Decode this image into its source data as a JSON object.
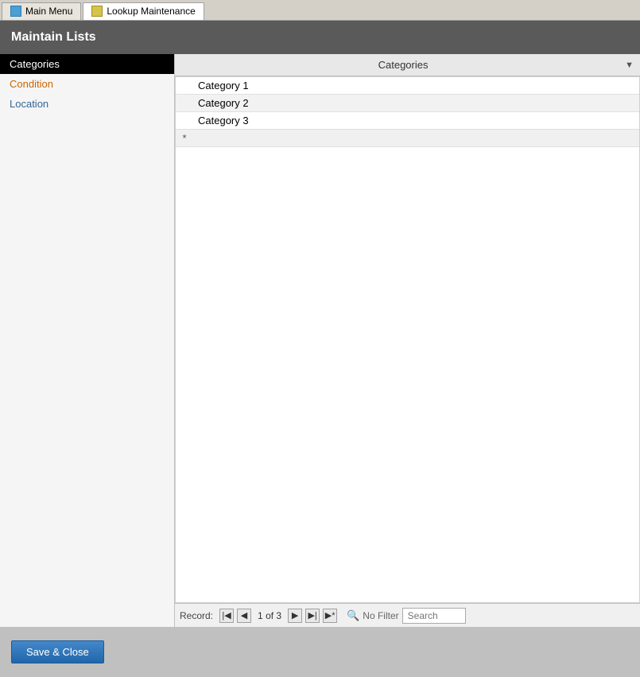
{
  "tabs": [
    {
      "id": "main-menu",
      "label": "Main Menu",
      "icon": "main-icon",
      "active": false
    },
    {
      "id": "lookup-maintenance",
      "label": "Lookup Maintenance",
      "icon": "lookup-icon",
      "active": true
    }
  ],
  "title": "Maintain Lists",
  "left_panel": {
    "items": [
      {
        "id": "categories",
        "label": "Categories",
        "selected": true
      },
      {
        "id": "condition",
        "label": "Condition"
      },
      {
        "id": "location",
        "label": "Location"
      }
    ]
  },
  "grid": {
    "column_header": "Categories",
    "rows": [
      {
        "id": 1,
        "value": "Category 1",
        "indicator": ""
      },
      {
        "id": 2,
        "value": "Category 2",
        "indicator": ""
      },
      {
        "id": 3,
        "value": "Category 3",
        "indicator": ""
      }
    ],
    "new_row_indicator": "*"
  },
  "nav": {
    "record_label": "Record:",
    "current": "1",
    "total": "3",
    "of_label": "of",
    "no_filter_label": "No Filter",
    "search_placeholder": "Search"
  },
  "buttons": {
    "save_close": "Save & Close"
  }
}
